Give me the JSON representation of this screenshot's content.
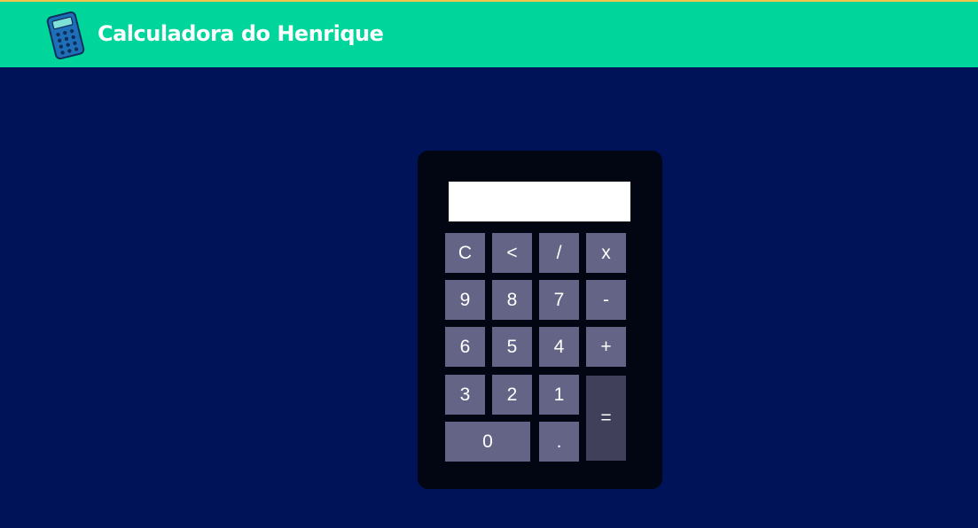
{
  "header": {
    "title": "Calculadora do Henrique",
    "background": "#00d69b",
    "logo_icon": "calculator-icon"
  },
  "calculator": {
    "display_value": "",
    "keys": {
      "clear": "C",
      "backspace": "<",
      "divide": "/",
      "multiply": "x",
      "nine": "9",
      "eight": "8",
      "seven": "7",
      "minus": "-",
      "six": "6",
      "five": "5",
      "four": "4",
      "plus": "+",
      "three": "3",
      "two": "2",
      "one": "1",
      "equals": "=",
      "zero": "0",
      "decimal": "."
    },
    "colors": {
      "body": "#020512",
      "key": "#646486",
      "equals_key": "#41405a",
      "page_background": "#001359"
    }
  }
}
